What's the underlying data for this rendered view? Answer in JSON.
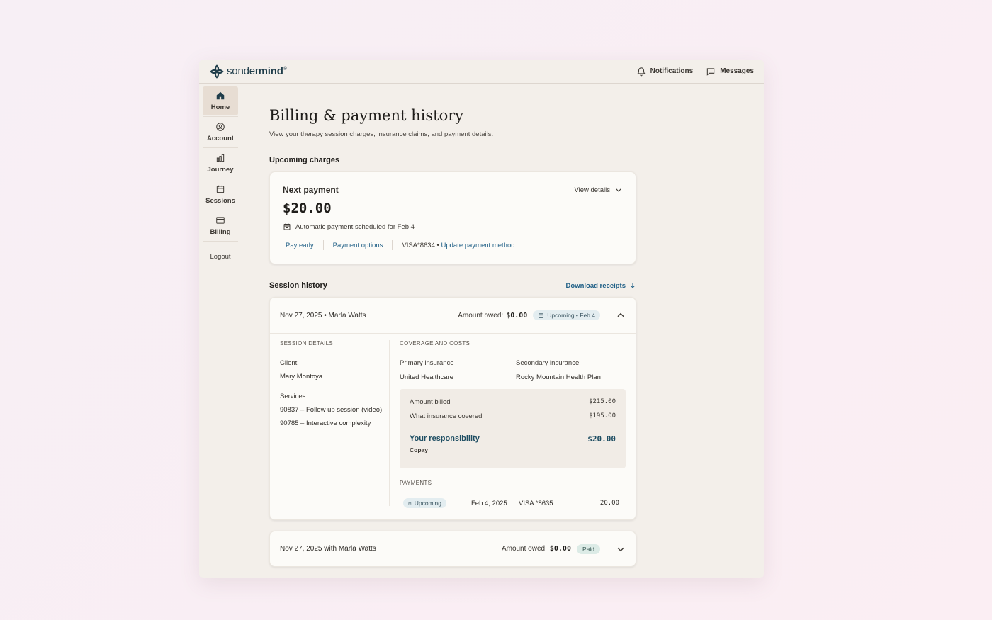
{
  "app": {
    "logo_text_a": "sonder",
    "logo_text_b": "mind",
    "logo_reg": "®"
  },
  "topbar": {
    "notifications": "Notifications",
    "messages": "Messages"
  },
  "sidebar": {
    "items": [
      {
        "label": "Home",
        "icon": "home-icon",
        "active": true
      },
      {
        "label": "Account",
        "icon": "user-circle-icon"
      },
      {
        "label": "Journey",
        "icon": "bar-chart-icon"
      },
      {
        "label": "Sessions",
        "icon": "calendar-icon"
      },
      {
        "label": "Billing",
        "icon": "credit-card-icon"
      }
    ],
    "logout": "Logout"
  },
  "page": {
    "title": "Billing & payment history",
    "subtitle": "View your therapy session charges, insurance claims, and payment details."
  },
  "upcoming": {
    "section_title": "Upcoming charges",
    "card_title": "Next payment",
    "view_details": "View details",
    "amount": "$20.00",
    "auto_text": "Automatic payment scheduled for Feb 4",
    "pay_early": "Pay early",
    "payment_options": "Payment options",
    "card_masked": "VISA*8634 •",
    "update_method": "Update payment method"
  },
  "history": {
    "section_title": "Session history",
    "download": "Download receipts",
    "sessions": [
      {
        "title": "Nov 27, 2025 • Marla Watts",
        "owed_label": "Amount owed:",
        "owed_value": "$0.00",
        "badge": "Upcoming • Feb 4",
        "details_caption": "Session details",
        "client_label": "Client",
        "client_value": "Mary Montoya",
        "services_label": "Services",
        "services": [
          "90837 – Follow up session (video)",
          "90785 – Interactive complexity"
        ],
        "coverage_caption": "Coverage and costs",
        "primary_label": "Primary insurance",
        "primary_value": "United Healthcare",
        "secondary_label": "Secondary insurance",
        "secondary_value": "Rocky Mountain Health Plan",
        "billed_label": "Amount billed",
        "billed_value": "$215.00",
        "covered_label": "What insurance covered",
        "covered_value": "$195.00",
        "resp_label": "Your responsibility",
        "resp_value": "$20.00",
        "resp_note": "Copay",
        "payments_caption": "Payments",
        "payment": {
          "status": "Upcoming",
          "date": "Feb 4, 2025",
          "method": "VISA *8635",
          "amount": "20.00"
        }
      },
      {
        "title": "Nov 27, 2025 with Marla Watts",
        "owed_label": "Amount owed:",
        "owed_value": "$0.00",
        "badge": "Paid"
      }
    ]
  },
  "colors": {
    "accent_link": "#1f5f86",
    "brand": "#1f3d4a",
    "responsibility": "#1f4e63"
  }
}
